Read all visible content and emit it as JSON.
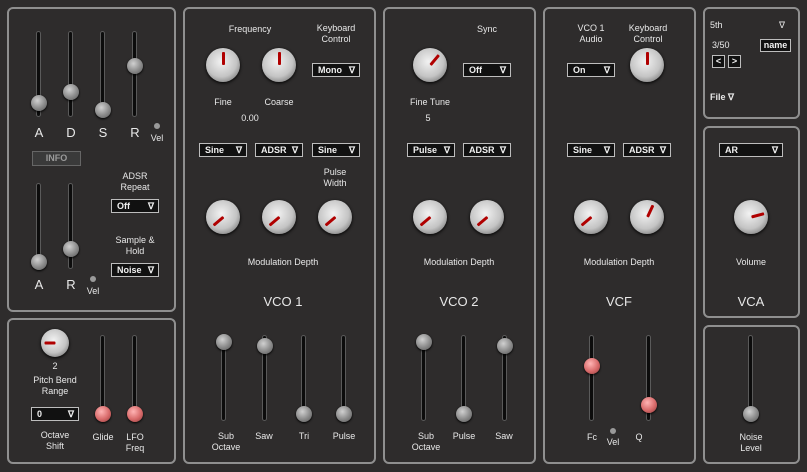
{
  "env": {
    "A": "A",
    "D": "D",
    "S": "S",
    "R": "R",
    "vel": "Vel",
    "info": "INFO",
    "adsr_repeat_label": "ADSR\nRepeat",
    "adsr_repeat_value": "Off",
    "sample_hold_label": "Sample &\nHold",
    "sample_hold_value": "Noise",
    "A2": "A",
    "R2": "R",
    "vel2": "Vel"
  },
  "bottom_left": {
    "pitch_bend_value": "2",
    "pitch_bend_label": "Pitch Bend\nRange",
    "octave_value": "0",
    "octave_label": "Octave\nShift",
    "glide": "Glide",
    "lfo_freq": "LFO\nFreq"
  },
  "vco1": {
    "frequency": "Frequency",
    "keyboard_control": "Keyboard\nControl",
    "keyboard_value": "Mono",
    "fine": "Fine",
    "coarse": "Coarse",
    "fine_value": "0.00",
    "wave1": "Sine",
    "env": "ADSR",
    "wave2": "Sine",
    "pulse_width": "Pulse\nWidth",
    "mod_depth": "Modulation Depth",
    "title": "VCO 1",
    "sub_octave": "Sub\nOctave",
    "saw": "Saw",
    "tri": "Tri",
    "pulse": "Pulse"
  },
  "vco2": {
    "sync": "Sync",
    "sync_value": "Off",
    "fine_tune": "Fine Tune",
    "fine_tune_value": "5",
    "wave1": "Pulse",
    "env": "ADSR",
    "mod_depth": "Modulation Depth",
    "title": "VCO 2",
    "sub_octave": "Sub\nOctave",
    "pulse": "Pulse",
    "saw": "Saw"
  },
  "vcf": {
    "vco1_audio": "VCO 1\nAudio",
    "vco1_audio_value": "On",
    "keyboard_control": "Keyboard\nControl",
    "wave1": "Sine",
    "env": "ADSR",
    "mod_depth": "Modulation Depth",
    "title": "VCF",
    "fc": "Fc",
    "vel": "Vel",
    "q": "Q"
  },
  "preset": {
    "name": "5th",
    "index": "3/50",
    "name_button": "name",
    "prev": "<",
    "next": ">",
    "file": "File"
  },
  "vca": {
    "env_value": "AR",
    "volume": "Volume",
    "title": "VCA"
  },
  "noise": {
    "label": "Noise\nLevel"
  },
  "arrow": "∇"
}
